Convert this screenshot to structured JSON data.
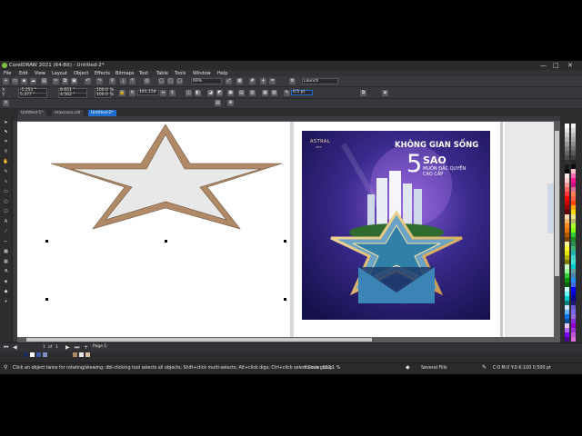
{
  "window": {
    "title": "CorelDRAW 2021 (64-Bit) - Untitled-2*",
    "minimize": "—",
    "maximize": "□",
    "close": "✕"
  },
  "menu": [
    "File",
    "Edit",
    "View",
    "Layout",
    "Object",
    "Effects",
    "Bitmaps",
    "Text",
    "Table",
    "Tools",
    "Window",
    "Help"
  ],
  "toolbar": {
    "zoom": "69%",
    "launch_label": "Launch",
    "pos_x": "-5.251 \"",
    "pos_y": "5.377 \"",
    "width": "8.651 \"",
    "height": "4.562 \"",
    "scale_w": "100.0",
    "scale_h": "100.0",
    "pct": "%",
    "angle": "191.154",
    "outline": "0.5 pt"
  },
  "tabs": [
    "Untitled-1*",
    "maxcoco.cdr",
    "Untitled-2*"
  ],
  "page_nav": {
    "current": "1",
    "of": "of",
    "total": "1",
    "page_label": "Page 1"
  },
  "status": {
    "hint": "Click an object twice for rotating/skewing; dbl-clicking tool selects all objects; Shift+click multi-selects; Alt+click digs; Ctrl+click selects in a group",
    "y_scale": "Y Scale: 122.1 %",
    "fill": "Several Fills",
    "outline_info": "C:0 M:0 Y:0 K:100  0.500 pt"
  },
  "artwork": {
    "brand_top": "ASTRAL",
    "brand_sub": "CITY",
    "headline": "KHÔNG GIAN SỐNG",
    "big_number": "5",
    "big_word": "SAO",
    "tagline1": "MUÔN ĐẶC QUYỀN",
    "tagline2": "CAO CẤP"
  },
  "colors": {
    "star_fill": "#e8e8e8",
    "star_outline": "#b08a66",
    "selection_blue": "#1f6fd1",
    "poster_bg": "#2b1f6a"
  }
}
